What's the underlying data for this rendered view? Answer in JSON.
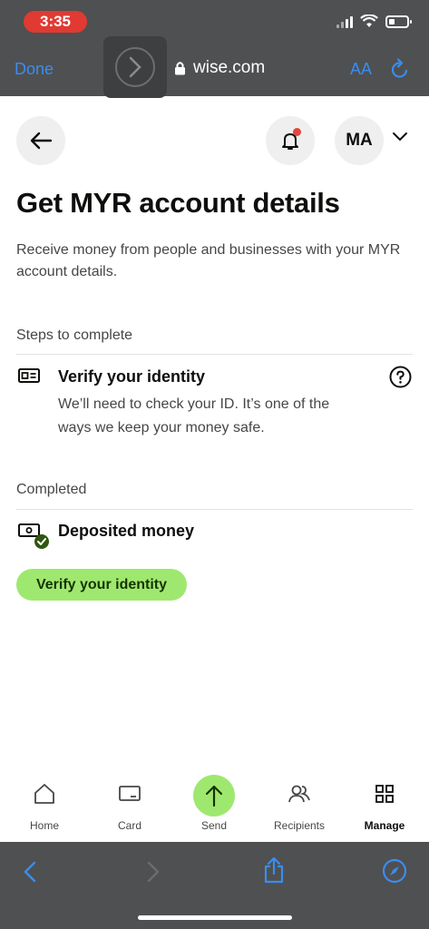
{
  "status_bar": {
    "time": "3:35"
  },
  "browser": {
    "done_label": "Done",
    "url": "wise.com",
    "text_size_label": "AA"
  },
  "header": {
    "avatar_initials": "MA"
  },
  "main": {
    "title": "Get MYR account details",
    "subtitle": "Receive money from people and businesses with your MYR account details.",
    "steps_label": "Steps to complete",
    "steps": [
      {
        "title": "Verify your identity",
        "description": "We’ll need to check your ID. It’s one of the ways we keep your money safe."
      }
    ],
    "completed_label": "Completed",
    "completed": [
      {
        "title": "Deposited money"
      }
    ],
    "cta_label": "Verify your identity"
  },
  "bottom_nav": {
    "items": [
      {
        "label": "Home",
        "icon": "home-icon"
      },
      {
        "label": "Card",
        "icon": "card-icon"
      },
      {
        "label": "Send",
        "icon": "send-arrow-icon"
      },
      {
        "label": "Recipients",
        "icon": "recipients-icon"
      },
      {
        "label": "Manage",
        "icon": "grid-icon",
        "active": true
      }
    ]
  },
  "colors": {
    "accent_green": "#9fe870",
    "safari_blue": "#3a8df0",
    "notification_red": "#e2473c",
    "chrome_gray": "#4f5051"
  }
}
